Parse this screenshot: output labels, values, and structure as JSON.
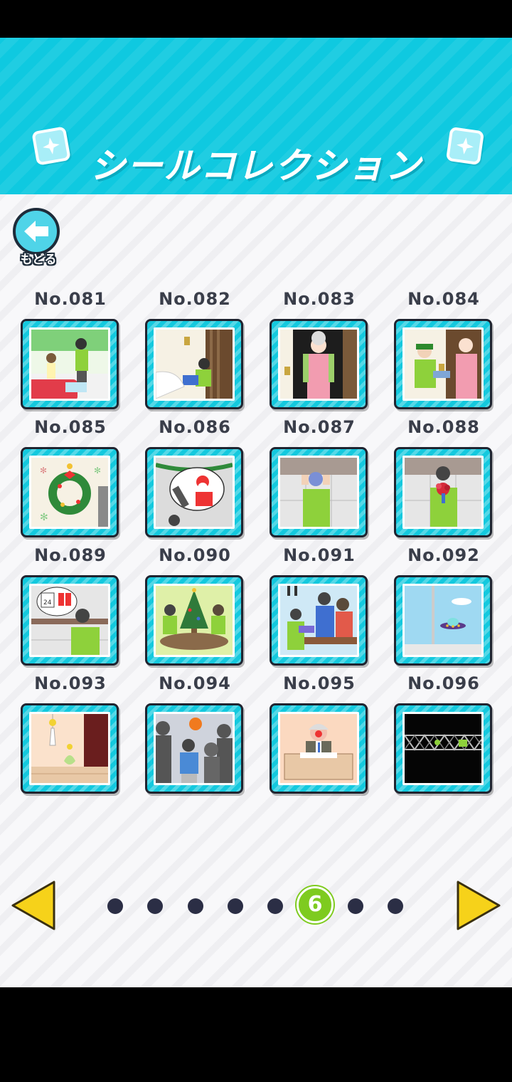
{
  "header": {
    "title": "シールコレクション"
  },
  "back_button": {
    "label": "もどる"
  },
  "stickers": [
    {
      "number": "No.081",
      "scene": "boy-girl-car"
    },
    {
      "number": "No.082",
      "scene": "boy-door-box"
    },
    {
      "number": "No.083",
      "scene": "mom-door"
    },
    {
      "number": "No.084",
      "scene": "delivery-mom"
    },
    {
      "number": "No.085",
      "scene": "wreath"
    },
    {
      "number": "No.086",
      "scene": "santa-thought"
    },
    {
      "number": "No.087",
      "scene": "boy-head-hold"
    },
    {
      "number": "No.088",
      "scene": "boy-bouquet"
    },
    {
      "number": "No.089",
      "scene": "boy-calendar-gift"
    },
    {
      "number": "No.090",
      "scene": "christmas-party"
    },
    {
      "number": "No.091",
      "scene": "boys-table"
    },
    {
      "number": "No.092",
      "scene": "ufo-window"
    },
    {
      "number": "No.093",
      "scene": "vase-room"
    },
    {
      "number": "No.094",
      "scene": "basketball-crowd"
    },
    {
      "number": "No.095",
      "scene": "old-man-desk"
    },
    {
      "number": "No.096",
      "scene": "dark-window"
    }
  ],
  "pager": {
    "active_page": "6",
    "total_pages": 8,
    "active_index": 5
  },
  "colors": {
    "header": "#0fc9e0",
    "frame": "#14c9de",
    "active_dot": "#7ecb1f",
    "arrow": "#f6d21a"
  }
}
